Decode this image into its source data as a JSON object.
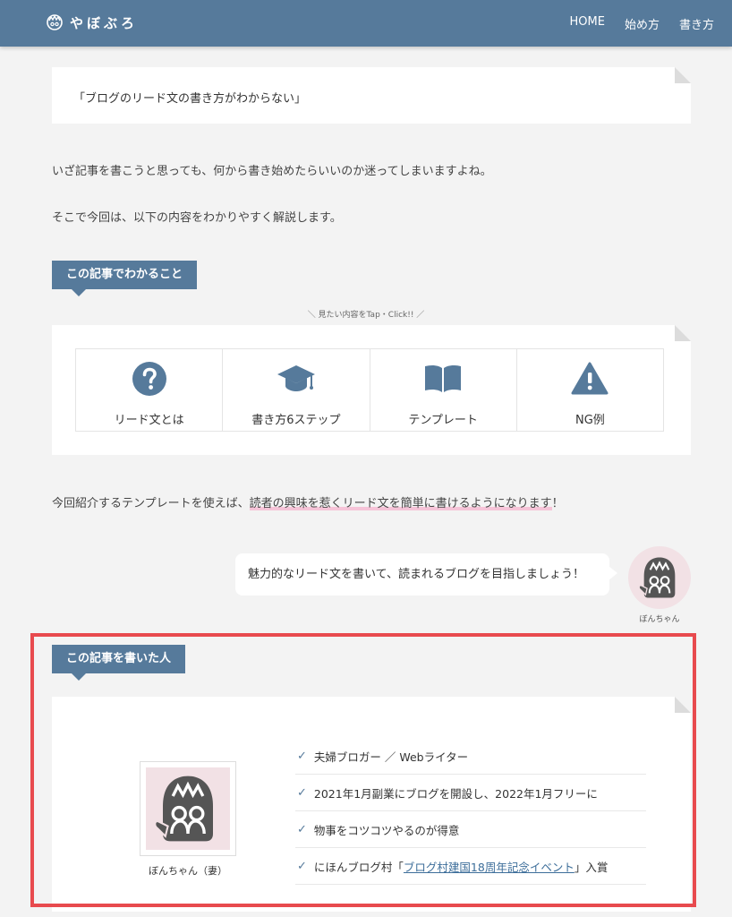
{
  "header": {
    "logo_text": "やぼぶろ",
    "nav": [
      "HOME",
      "始め方",
      "書き方"
    ]
  },
  "quote": "「ブログのリード文の書き方がわからない」",
  "intro": {
    "p1": "いざ記事を書こうと思っても、何から書き始めたらいいのか迷ってしまいますよね。",
    "p2": "そこで今回は、以下の内容をわかりやすく解説します。"
  },
  "toc": {
    "heading": "この記事でわかること",
    "tap_note": "＼ 見たい内容をTap・Click!! ／",
    "items": [
      {
        "label": "リード文とは",
        "icon": "question-circle-icon"
      },
      {
        "label": "書き方6ステップ",
        "icon": "graduation-cap-icon"
      },
      {
        "label": "テンプレート",
        "icon": "open-book-icon"
      },
      {
        "label": "NG例",
        "icon": "warning-triangle-icon"
      }
    ]
  },
  "template_sentence": {
    "before": "今回紹介するテンプレートを使えば、",
    "highlight": "読者の興味を惹くリード文を簡単に書けるようになります",
    "after": "！"
  },
  "speech": {
    "text": "魅力的なリード文を書いて、読まれるブログを目指しましょう！",
    "speaker": "ぼんちゃん"
  },
  "author": {
    "heading": "この記事を書いた人",
    "name": "ぼんちゃん（妻）",
    "points": [
      "夫婦ブロガー ／ Webライター",
      "2021年1月副業にブログを開設し、2022年1月フリーに",
      "物事をコツコツやるのが得意"
    ],
    "award": {
      "before": "にほんブログ村「",
      "link": "ブログ村建国18周年記念イベント",
      "after": "」入賞"
    }
  },
  "colors": {
    "header_bg": "#567a9b",
    "page_bg": "#f3f3f3",
    "highlight": "#f6c4d8",
    "frame": "#e84a4e",
    "avatar_bg": "#f2e1e5"
  }
}
